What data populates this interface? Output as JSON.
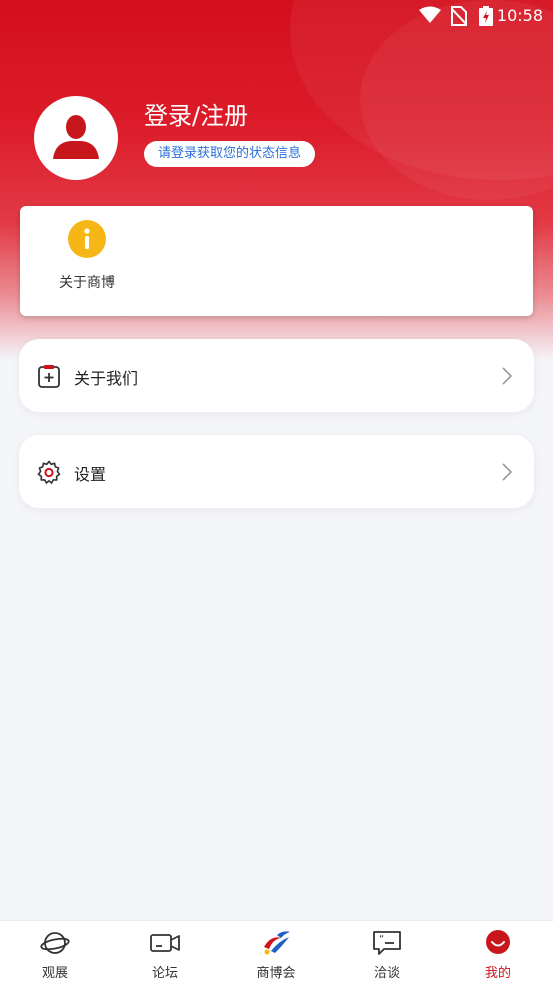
{
  "status_bar": {
    "time": "10:58",
    "icons": [
      "wifi-icon",
      "no-sim-icon",
      "battery-charging-icon"
    ]
  },
  "profile": {
    "title": "登录/注册",
    "hint": "请登录获取您的状态信息",
    "avatar_icon": "user-silhouette-icon"
  },
  "about_card": {
    "items": [
      {
        "label": "关于商博",
        "icon": "info-icon"
      }
    ]
  },
  "menu": {
    "items": [
      {
        "label": "关于我们",
        "icon": "clipboard-plus-icon"
      },
      {
        "label": "设置",
        "icon": "gear-icon"
      }
    ]
  },
  "tabbar": {
    "tabs": [
      {
        "label": "观展",
        "icon": "planet-icon"
      },
      {
        "label": "论坛",
        "icon": "video-camera-icon"
      },
      {
        "label": "商博会",
        "icon": "expo-logo-icon"
      },
      {
        "label": "洽谈",
        "icon": "chat-quote-icon"
      },
      {
        "label": "我的",
        "icon": "profile-face-icon"
      }
    ],
    "active_index": 4
  },
  "colors": {
    "brand_red": "#d40f1d",
    "active_tab": "#c8161d",
    "hint_text": "#2a6fdc",
    "info_yellow": "#f6b716",
    "page_bg": "#f4f5f9"
  }
}
